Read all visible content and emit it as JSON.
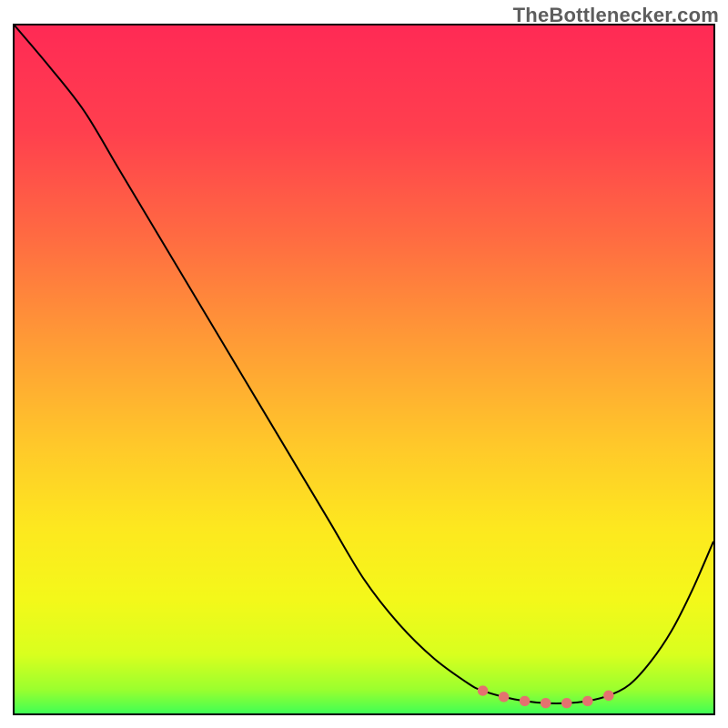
{
  "attribution": "TheBottlenecker.com",
  "chart_data": {
    "type": "line",
    "title": "",
    "xlabel": "",
    "ylabel": "",
    "xlim": [
      0,
      100
    ],
    "ylim": [
      0,
      100
    ],
    "x": [
      0,
      5,
      10,
      15,
      20,
      25,
      30,
      35,
      40,
      45,
      50,
      55,
      60,
      65,
      67,
      70,
      73,
      76,
      79,
      82,
      85,
      88,
      91,
      94,
      97,
      100
    ],
    "values": [
      100,
      94,
      87.5,
      79,
      70.5,
      62,
      53.5,
      45,
      36.5,
      28,
      19.5,
      13,
      8,
      4.3,
      3.3,
      2.4,
      1.8,
      1.5,
      1.5,
      1.8,
      2.6,
      4.2,
      7.5,
      12,
      18,
      25
    ],
    "marker_region": {
      "x": [
        67,
        70,
        73,
        76,
        79,
        82,
        85
      ],
      "values": [
        3.3,
        2.4,
        1.8,
        1.5,
        1.5,
        1.8,
        2.6
      ]
    },
    "gradient_stops": [
      {
        "offset": 0.0,
        "color": "#ff2a55"
      },
      {
        "offset": 0.15,
        "color": "#ff3f4e"
      },
      {
        "offset": 0.3,
        "color": "#ff6a42"
      },
      {
        "offset": 0.45,
        "color": "#ff9a36"
      },
      {
        "offset": 0.6,
        "color": "#ffc82a"
      },
      {
        "offset": 0.72,
        "color": "#fde81f"
      },
      {
        "offset": 0.82,
        "color": "#f4f81a"
      },
      {
        "offset": 0.9,
        "color": "#d9ff1e"
      },
      {
        "offset": 0.95,
        "color": "#9bff2e"
      },
      {
        "offset": 0.985,
        "color": "#3fff55"
      },
      {
        "offset": 1.0,
        "color": "#00e561"
      }
    ]
  }
}
